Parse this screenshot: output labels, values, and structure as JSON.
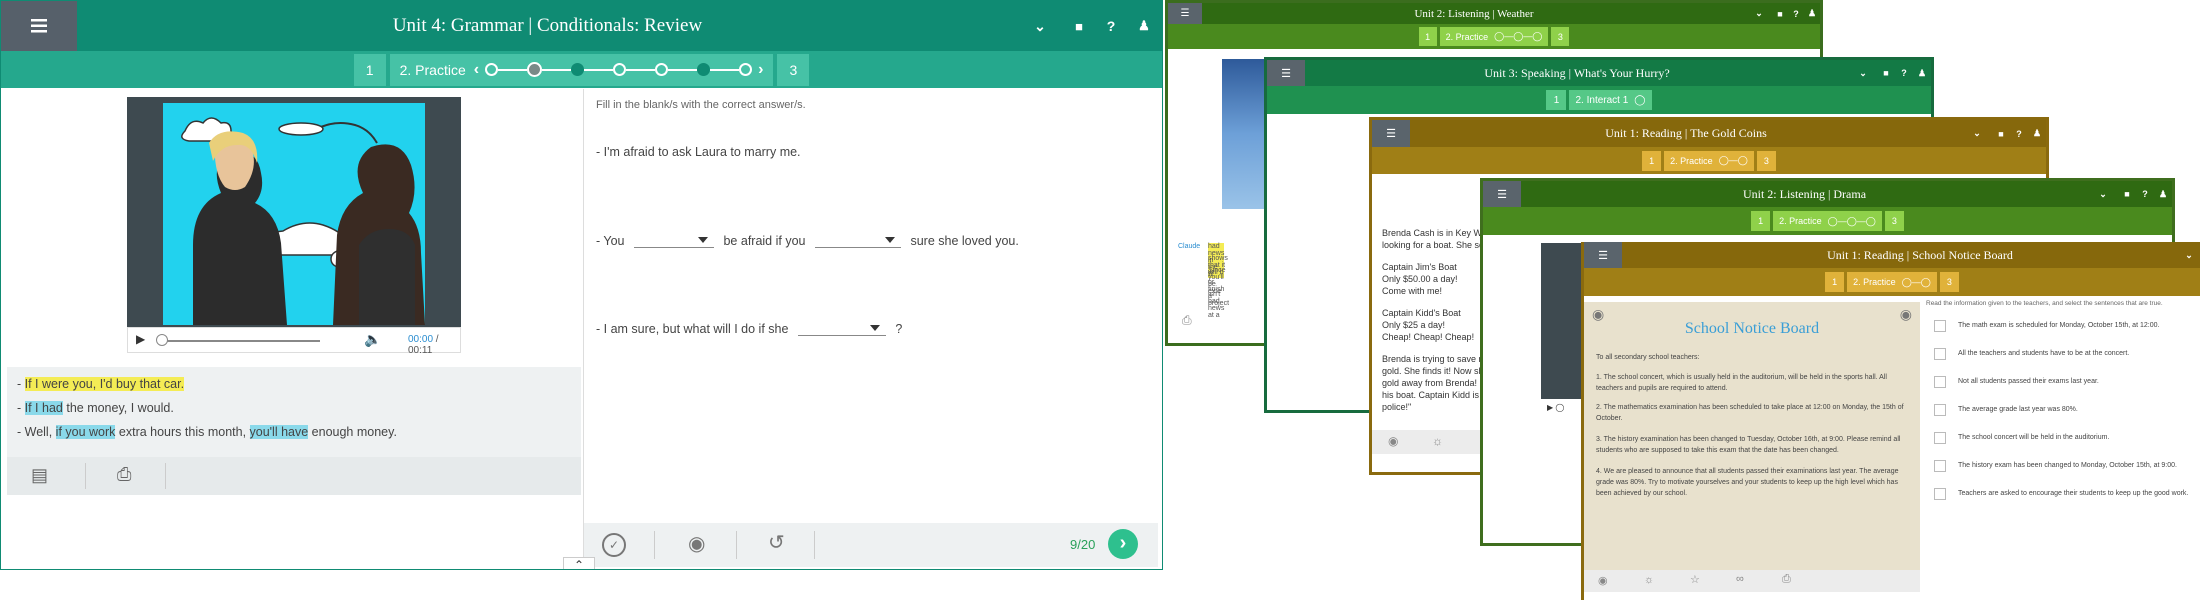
{
  "main": {
    "header_title": "Unit 4: Grammar | Conditionals: Review",
    "steps": [
      "1",
      "2. Practice",
      "3"
    ],
    "instruction": "Fill in the blank/s with the correct answer/s.",
    "q1": "- I'm afraid to ask Laura to marry me.",
    "q2_part1": "- You",
    "q2_part2": "be afraid if you",
    "q2_part3": "sure she loved you.",
    "q3_part1": "- I am sure, but what will I do if she",
    "q3_part2": "?",
    "video_time_current": "00:00",
    "video_time_sep": " / ",
    "video_time_total": "00:11",
    "example_prefix1": "- ",
    "ex1_a": "If I were",
    "ex1_b": " you, ",
    "ex1_c": "I'd buy",
    "ex1_d": " that car.",
    "ex2_prefix": "- ",
    "ex2_a": "If I had",
    "ex2_b": " the money, I would.",
    "ex3_prefix": "- Well, ",
    "ex3_a": "if you work",
    "ex3_b": " extra hours this month, ",
    "ex3_c": "you'll have",
    "ex3_d": " enough money.",
    "score": "9/20",
    "colors": {
      "header": "#0f8b73",
      "subbar": "#25a88d",
      "step": "#46c2a6"
    }
  },
  "weather": {
    "title": "Unit 2: Listening | Weather",
    "steps": [
      "1",
      "2. Practice",
      "3"
    ],
    "note_name": "Claude",
    "note_lines": [
      "had news in the w",
      "shows that it will b",
      "Since you'll be exte",
      "or finish a project",
      "isn't bad news at a"
    ]
  },
  "speaking": {
    "title": "Unit 3: Speaking | What's Your Hurry?",
    "steps": [
      "1",
      "2. Interact 1"
    ]
  },
  "gold": {
    "title": "Unit 1: Reading | The Gold Coins",
    "steps": [
      "1",
      "2. Practice",
      "3"
    ],
    "lines": [
      "Brenda Cash is in Key West, Flor",
      "looking for a boat. She sees two",
      "",
      "Captain Jim's Boat",
      "Only $50.00 a day!",
      "Come with me!",
      "",
      "Captain Kidd's Boat",
      "Only $25 a day!",
      "Cheap! Cheap! Cheap!",
      "",
      "Brenda is trying to save money. S",
      "gold. She finds it! Now she is ca",
      "gold away from Brenda! But Bren",
      "his boat. Captain Kidd is shoutin",
      "police!\""
    ]
  },
  "drama": {
    "title": "Unit 2: Listening | Drama",
    "steps": [
      "1",
      "2. Practice",
      "3"
    ]
  },
  "notice": {
    "title": "Unit 1: Reading | School Notice Board",
    "steps": [
      "1",
      "2. Practice",
      "3"
    ],
    "board_title": "School Notice Board",
    "greeting": "To all secondary school teachers:",
    "items": [
      "1. The school concert, which is usually held in the auditorium, will be held in the sports hall. All teachers and pupils are required to attend.",
      "2. The mathematics examination has been scheduled to take place at 12:00 on Monday, the 15th of October.",
      "3. The history examination has been changed to Tuesday, October 16th, at 9:00. Please remind all students who are supposed to take this exam that the date has been changed.",
      "4. We are pleased to announce that all students passed their examinations last year. The average grade was 80%. Try to motivate yourselves and your students to keep up the high level which has been achieved by our school."
    ],
    "instruction": "Read the information given to the teachers, and select the sentences that are true.",
    "options": [
      "The math exam is scheduled for Monday, October 15th, at 12:00.",
      "All the teachers and students have to be at the concert.",
      "Not all students passed their exams last year.",
      "The average grade last year was 80%.",
      "The school concert will be held in the auditorium.",
      "The history exam has been changed to Monday, October 15th, at 9:00.",
      "Teachers are asked to encourage their students to keep up the good work."
    ]
  }
}
